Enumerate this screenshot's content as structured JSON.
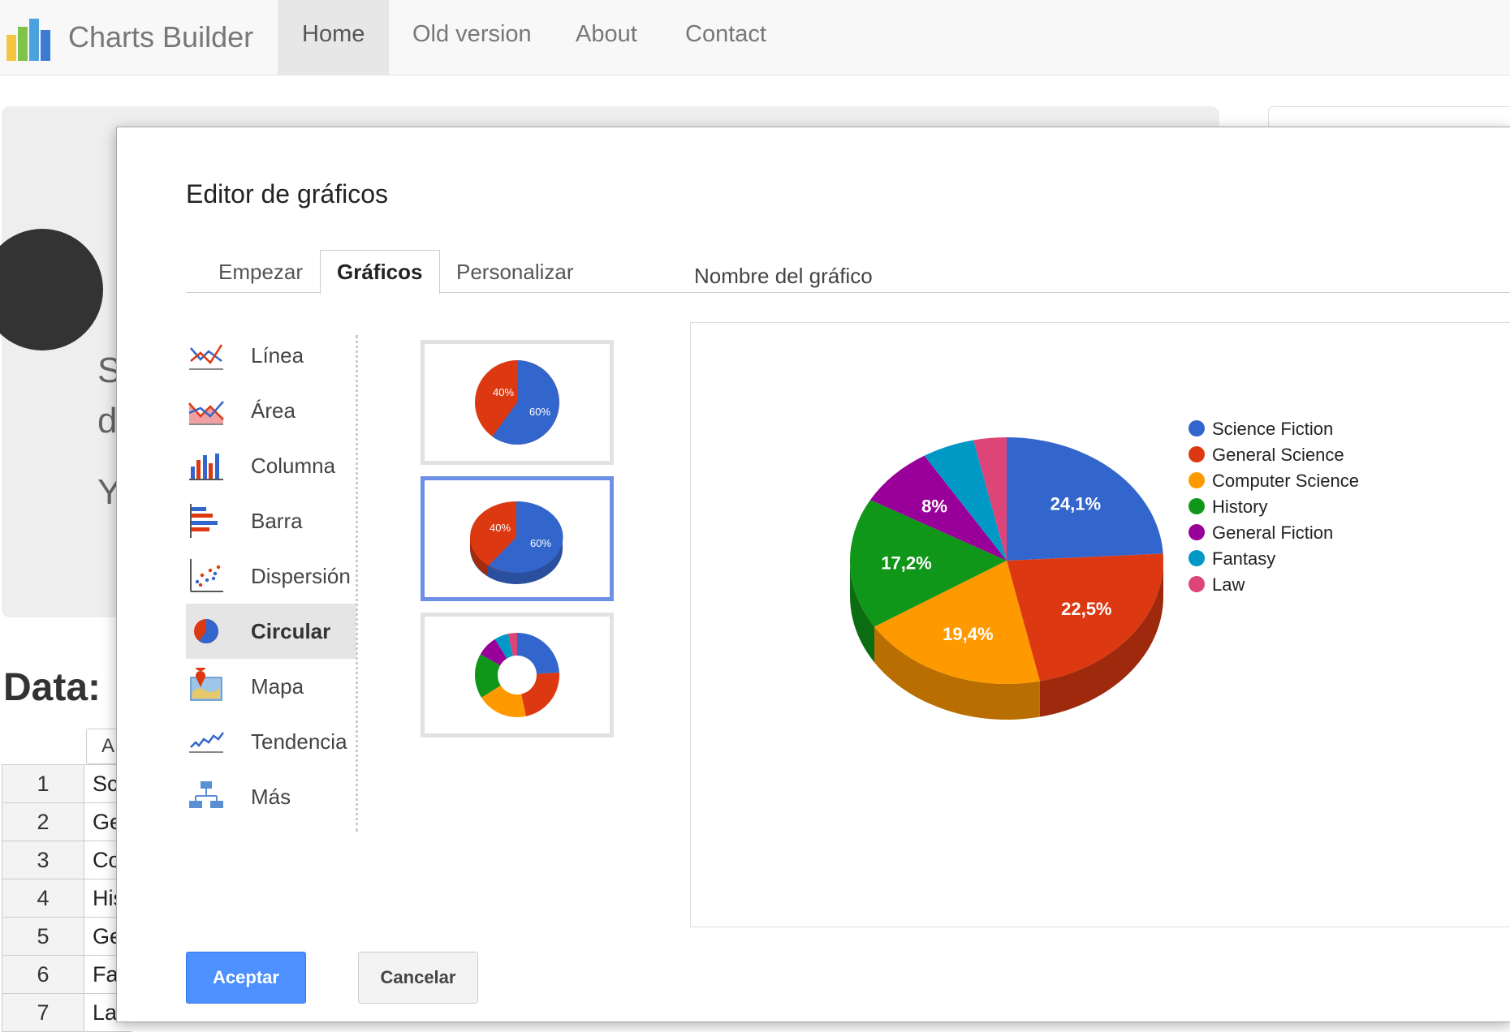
{
  "navbar": {
    "brand": "Charts Builder",
    "items": [
      "Home",
      "Old version",
      "About",
      "Contact"
    ],
    "active": "Home"
  },
  "background": {
    "letters": [
      "S",
      "d",
      "Y"
    ],
    "data_heading": "Data:",
    "column_header": "A",
    "rows": [
      {
        "num": "1",
        "cell": "Sc"
      },
      {
        "num": "2",
        "cell": "Ge"
      },
      {
        "num": "3",
        "cell": "Co"
      },
      {
        "num": "4",
        "cell": "His"
      },
      {
        "num": "5",
        "cell": "Ge"
      },
      {
        "num": "6",
        "cell": "Fa"
      },
      {
        "num": "7",
        "cell": "La"
      }
    ]
  },
  "dialog": {
    "title": "Editor de gráficos",
    "tabs": [
      "Empezar",
      "Gráficos",
      "Personalizar"
    ],
    "active_tab": "Gráficos",
    "chart_name_label": "Nombre del gráfico",
    "chart_types": [
      {
        "label": "Línea",
        "icon": "line-chart-icon"
      },
      {
        "label": "Área",
        "icon": "area-chart-icon"
      },
      {
        "label": "Columna",
        "icon": "column-chart-icon"
      },
      {
        "label": "Barra",
        "icon": "bar-chart-icon"
      },
      {
        "label": "Dispersión",
        "icon": "scatter-chart-icon"
      },
      {
        "label": "Circular",
        "icon": "pie-chart-icon"
      },
      {
        "label": "Mapa",
        "icon": "map-icon"
      },
      {
        "label": "Tendencia",
        "icon": "trend-icon"
      },
      {
        "label": "Más",
        "icon": "more-charts-icon"
      }
    ],
    "selected_type": "Circular",
    "thumbnails": [
      {
        "style": "pie",
        "labels": [
          "40%",
          "60%"
        ]
      },
      {
        "style": "3d-pie",
        "labels": [
          "40%",
          "60%"
        ]
      },
      {
        "style": "donut",
        "labels": []
      }
    ],
    "selected_thumbnail": 1,
    "buttons": {
      "ok": "Aceptar",
      "cancel": "Cancelar"
    }
  },
  "chart_data": {
    "type": "pie",
    "style": "3d",
    "legend_position": "right",
    "slices": [
      {
        "name": "Science Fiction",
        "value": 24.1,
        "label": "24,1%",
        "color": "#3366cc"
      },
      {
        "name": "General Science",
        "value": 22.5,
        "label": "22,5%",
        "color": "#dc3912"
      },
      {
        "name": "Computer Science",
        "value": 19.4,
        "label": "19,4%",
        "color": "#ff9900"
      },
      {
        "name": "History",
        "value": 17.2,
        "label": "17,2%",
        "color": "#109618"
      },
      {
        "name": "General Fiction",
        "value": 8.0,
        "label": "8%",
        "color": "#990099"
      },
      {
        "name": "Fantasy",
        "value": 5.4,
        "label": "",
        "color": "#0099c6"
      },
      {
        "name": "Law",
        "value": 3.4,
        "label": "",
        "color": "#dd4477"
      }
    ]
  }
}
